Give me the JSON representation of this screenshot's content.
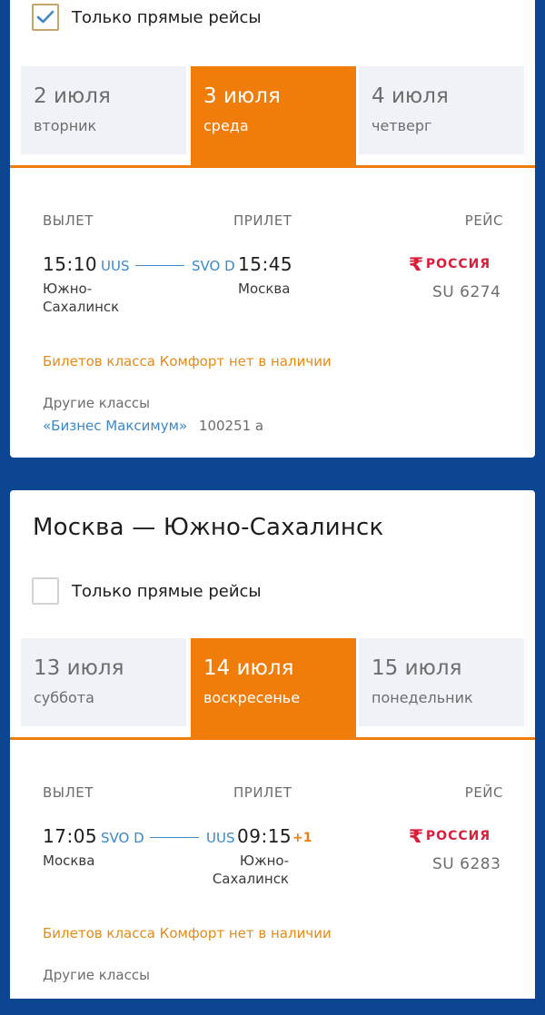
{
  "outbound": {
    "direct_only_label": "Только прямые рейсы",
    "direct_only_checked": true,
    "dates": [
      {
        "date": "2 июля",
        "weekday": "вторник",
        "active": false
      },
      {
        "date": "3 июля",
        "weekday": "среда",
        "active": true
      },
      {
        "date": "4 июля",
        "weekday": "четверг",
        "active": false
      }
    ],
    "headers": {
      "departure": "ВЫЛЕТ",
      "arrival": "ПРИЛЕТ",
      "flight": "РЕЙС"
    },
    "flight": {
      "dep_time": "15:10",
      "dep_code": "UUS",
      "arr_code": "SVO D",
      "arr_time": "15:45",
      "dep_city_line1": "Южно-",
      "dep_city_line2": "Сахалинск",
      "arr_city": "Москва",
      "airline": "РОССИЯ",
      "airline_logo_icon": "rossiya-logo-icon",
      "flight_no": "SU 6274",
      "notice": "Билетов класса Комфорт нет в наличии",
      "other_classes_label": "Другие классы",
      "other_class_name": "«Бизнес Максимум»",
      "other_class_price": "100251 a"
    }
  },
  "return": {
    "title": "Москва — Южно-Сахалинск",
    "direct_only_label": "Только прямые рейсы",
    "direct_only_checked": false,
    "dates": [
      {
        "date": "13 июля",
        "weekday": "суббота",
        "active": false
      },
      {
        "date": "14 июля",
        "weekday": "воскресенье",
        "active": true
      },
      {
        "date": "15 июля",
        "weekday": "понедельник",
        "active": false
      }
    ],
    "headers": {
      "departure": "ВЫЛЕТ",
      "arrival": "ПРИЛЕТ",
      "flight": "РЕЙС"
    },
    "flight": {
      "dep_time": "17:05",
      "dep_code": "SVO D",
      "arr_code": "UUS",
      "arr_time": "09:15",
      "next_day": "+1",
      "dep_city": "Москва",
      "arr_city_line1": "Южно-",
      "arr_city_line2": "Сахалинск",
      "airline": "РОССИЯ",
      "airline_logo_icon": "rossiya-logo-icon",
      "flight_no": "SU 6283",
      "notice": "Билетов класса Комфорт нет в наличии",
      "other_classes_label": "Другие классы"
    }
  },
  "colors": {
    "background": "#0c4591",
    "accent": "#f07c0a",
    "link": "#3d88c5",
    "notice": "#e58b16",
    "airline": "#d81e3a"
  }
}
